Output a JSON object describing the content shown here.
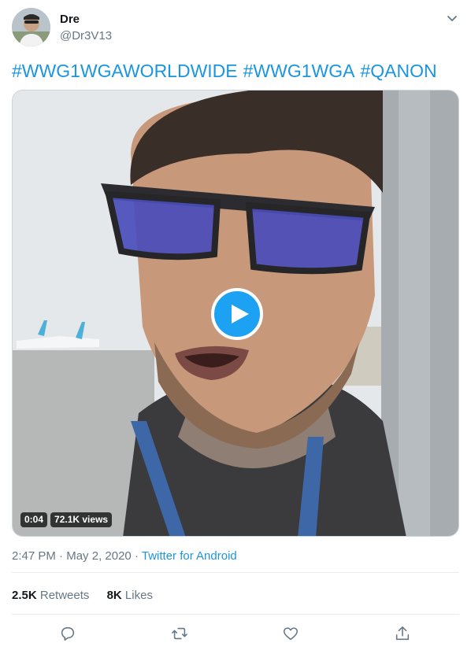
{
  "author": {
    "name": "Dre",
    "handle": "@Dr3V13",
    "avatar_icon": "person-avatar"
  },
  "tweet": {
    "hashtags": [
      "#WWG1WGAWORLDWIDE",
      "#WWG1WGA",
      "#QANON"
    ]
  },
  "video": {
    "duration": "0:04",
    "views": "72.1K views",
    "play_icon": "play-icon"
  },
  "meta": {
    "time": "2:47 PM",
    "dot": "·",
    "date": "May 2, 2020",
    "source": "Twitter for Android"
  },
  "stats": {
    "retweets_count": "2.5K",
    "retweets_label": "Retweets",
    "likes_count": "8K",
    "likes_label": "Likes"
  },
  "actions": [
    "reply-icon",
    "retweet-icon",
    "like-icon",
    "share-icon"
  ],
  "colors": {
    "link": "#1b95e0",
    "accent": "#1da1f2",
    "secondary_text": "#657786",
    "primary_text": "#14171a"
  }
}
